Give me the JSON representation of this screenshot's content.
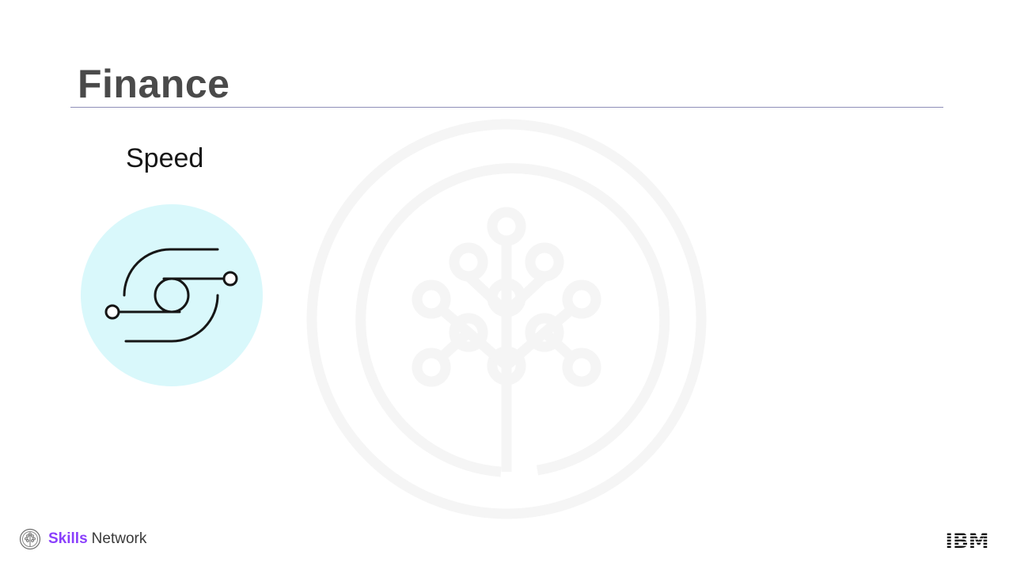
{
  "slide": {
    "title": "Finance",
    "subheading": "Speed"
  },
  "icons": {
    "watermark": "skills-network-tree-icon",
    "topic": "speed-loop-icon",
    "brand": "skills-network-tree-icon",
    "ibm": "ibm-logo"
  },
  "colors": {
    "title": "#4a4a4a",
    "rule": "#8e8fb8",
    "icon_circle": "#d9f8fb",
    "brand_accent": "#8a3ffc"
  },
  "footer": {
    "brand_bold": "Skills",
    "brand_rest": "Network",
    "ibm_logo_text": "IBM"
  }
}
